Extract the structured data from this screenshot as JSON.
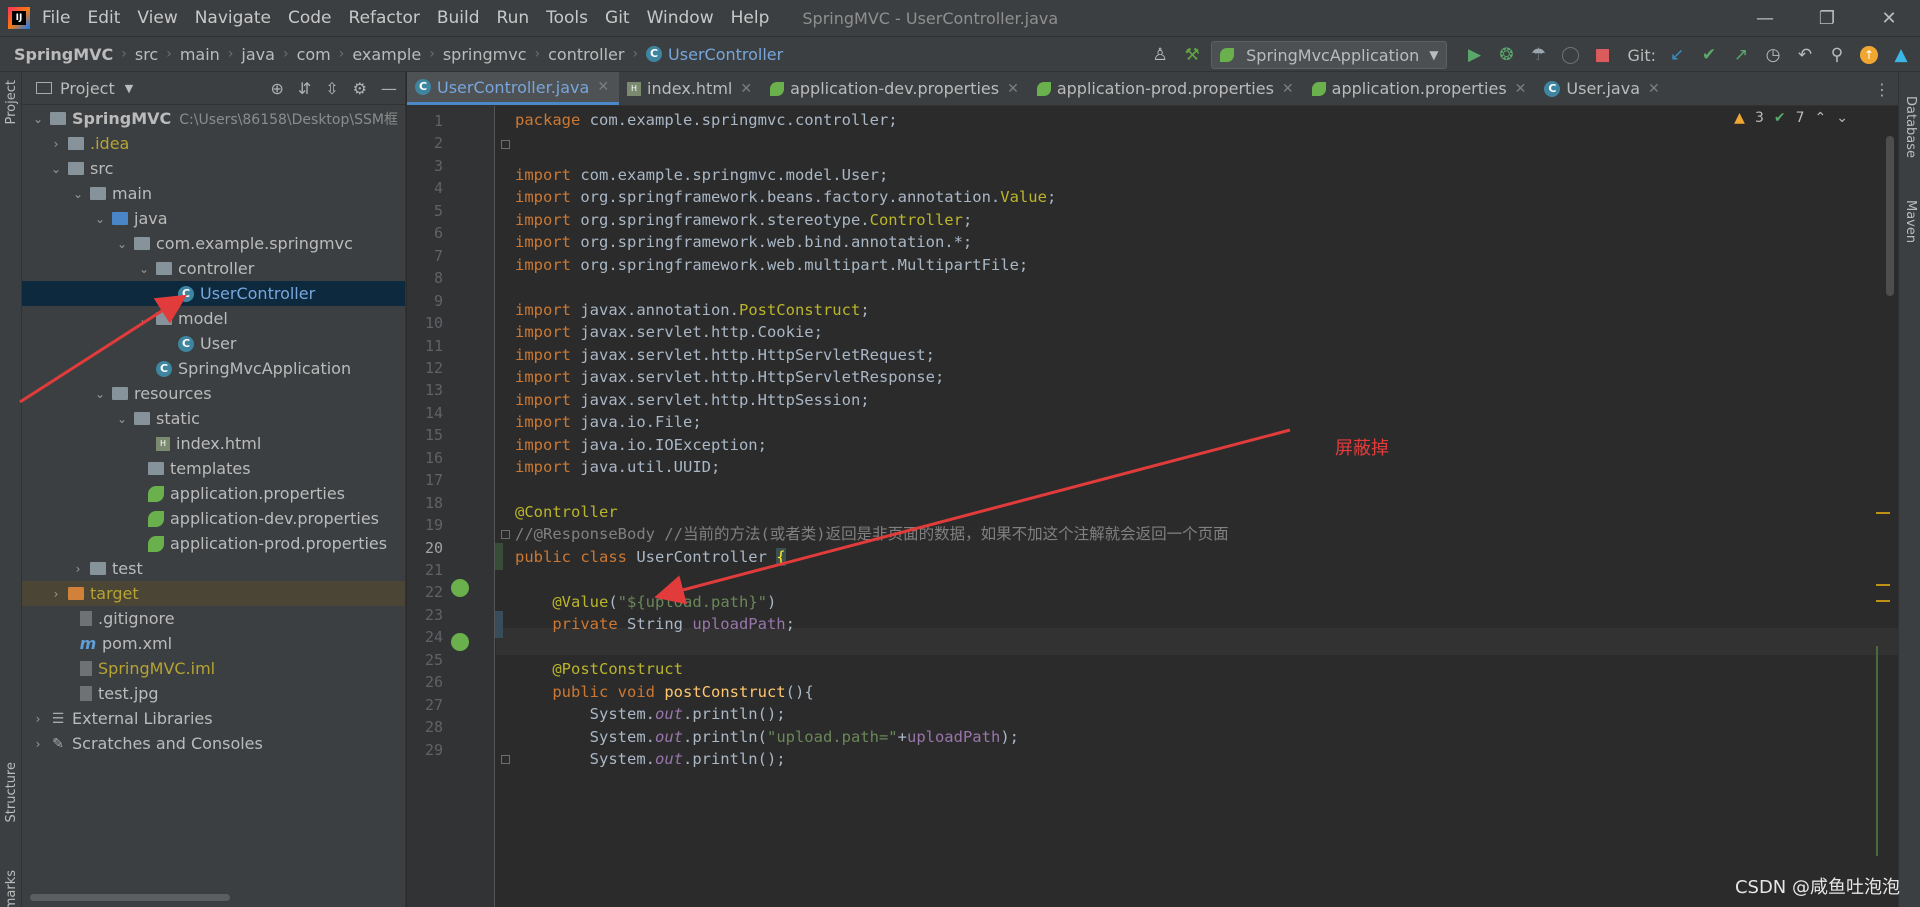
{
  "menu": {
    "items": [
      "File",
      "Edit",
      "View",
      "Navigate",
      "Code",
      "Refactor",
      "Build",
      "Run",
      "Tools",
      "Git",
      "Window",
      "Help"
    ],
    "window_title": "SpringMVC - UserController.java"
  },
  "breadcrumb": [
    "SpringMVC",
    "src",
    "main",
    "java",
    "com",
    "example",
    "springmvc",
    "controller",
    "UserController"
  ],
  "toolbar": {
    "run_config": "SpringMvcApplication",
    "git_label": "Git:"
  },
  "project_panel": {
    "title": "Project",
    "tree": [
      {
        "label": "SpringMVC",
        "hint": "C:\\Users\\86158\\Desktop\\SSM框",
        "type": "module"
      },
      {
        "label": ".idea",
        "type": "folder"
      },
      {
        "label": "src",
        "type": "folder"
      },
      {
        "label": "main",
        "type": "folder"
      },
      {
        "label": "java",
        "type": "folder"
      },
      {
        "label": "com.example.springmvc",
        "type": "package"
      },
      {
        "label": "controller",
        "type": "package"
      },
      {
        "label": "UserController",
        "type": "class"
      },
      {
        "label": "model",
        "type": "package"
      },
      {
        "label": "User",
        "type": "class"
      },
      {
        "label": "SpringMvcApplication",
        "type": "spring-class"
      },
      {
        "label": "resources",
        "type": "folder"
      },
      {
        "label": "static",
        "type": "folder"
      },
      {
        "label": "index.html",
        "type": "html"
      },
      {
        "label": "templates",
        "type": "folder"
      },
      {
        "label": "application.properties",
        "type": "props"
      },
      {
        "label": "application-dev.properties",
        "type": "props"
      },
      {
        "label": "application-prod.properties",
        "type": "props"
      },
      {
        "label": "test",
        "type": "folder"
      },
      {
        "label": "target",
        "type": "folder-excluded"
      },
      {
        "label": ".gitignore",
        "type": "file"
      },
      {
        "label": "pom.xml",
        "type": "maven"
      },
      {
        "label": "SpringMVC.iml",
        "type": "iml"
      },
      {
        "label": "test.jpg",
        "type": "image"
      },
      {
        "label": "External Libraries",
        "type": "libs"
      },
      {
        "label": "Scratches and Consoles",
        "type": "scratches"
      }
    ]
  },
  "tabs": [
    {
      "label": "UserController.java",
      "active": true
    },
    {
      "label": "index.html",
      "active": false
    },
    {
      "label": "application-dev.properties",
      "active": false
    },
    {
      "label": "application-prod.properties",
      "active": false
    },
    {
      "label": "application.properties",
      "active": false
    },
    {
      "label": "User.java",
      "active": false
    }
  ],
  "side_strips": {
    "left": [
      "Project",
      "Structure",
      "marks"
    ],
    "right": [
      "Database",
      "Maven"
    ]
  },
  "inspections": {
    "warnings": "3",
    "weak_warnings": "7"
  },
  "editor": {
    "line_numbers": [
      "1",
      "2",
      "3",
      "4",
      "5",
      "6",
      "7",
      "8",
      "9",
      "10",
      "11",
      "12",
      "13",
      "14",
      "15",
      "16",
      "17",
      "18",
      "19",
      "20",
      "21",
      "22",
      "23",
      "24",
      "25",
      "26",
      "27",
      "28",
      "29"
    ],
    "current_line": "20"
  },
  "annotation_text": "屏蔽掉",
  "watermark": "CSDN @咸鱼吐泡泡",
  "colors": {
    "arrow": "#e23b3b",
    "accent": "#4a88c7",
    "keyword": "#cc7832",
    "annotation": "#bbb529"
  }
}
